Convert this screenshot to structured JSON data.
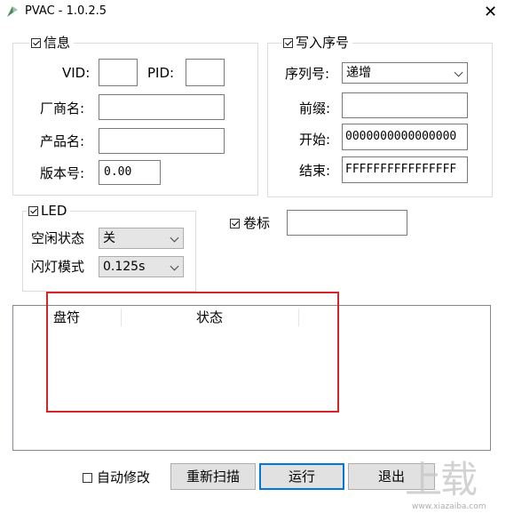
{
  "window": {
    "title": "PVAC - 1.0.2.5",
    "close": "✕"
  },
  "info": {
    "group_label": "信息",
    "checked": true,
    "vid_label": "VID:",
    "vid_value": "",
    "pid_label": "PID:",
    "pid_value": "",
    "vendor_label": "厂商名:",
    "vendor_value": "",
    "product_label": "产品名:",
    "product_value": "",
    "version_label": "版本号:",
    "version_value": "0.00"
  },
  "serial": {
    "group_label": "写入序号",
    "checked": true,
    "mode_label": "序列号:",
    "mode_value": "递增",
    "prefix_label": "前缀:",
    "prefix_value": "",
    "start_label": "开始:",
    "start_value": "0000000000000000",
    "end_label": "结束:",
    "end_value": "FFFFFFFFFFFFFFFF"
  },
  "led": {
    "group_label": "LED",
    "checked": true,
    "idle_label": "空闲状态",
    "idle_value": "关",
    "blink_label": "闪灯模式",
    "blink_value": "0.125s"
  },
  "volume": {
    "label": "卷标",
    "checked": true,
    "value": ""
  },
  "table": {
    "columns": [
      "盘符",
      "状态"
    ]
  },
  "footer": {
    "auto_fix_label": "自动修改",
    "auto_fix_checked": false,
    "rescan_label": "重新扫描",
    "run_label": "运行",
    "exit_label": "退出"
  },
  "watermark": {
    "main": "上载",
    "sub": "www.xiazaiba.com"
  },
  "colors": {
    "highlight_box": "#d6252a",
    "default_button_border": "#0078d7"
  }
}
